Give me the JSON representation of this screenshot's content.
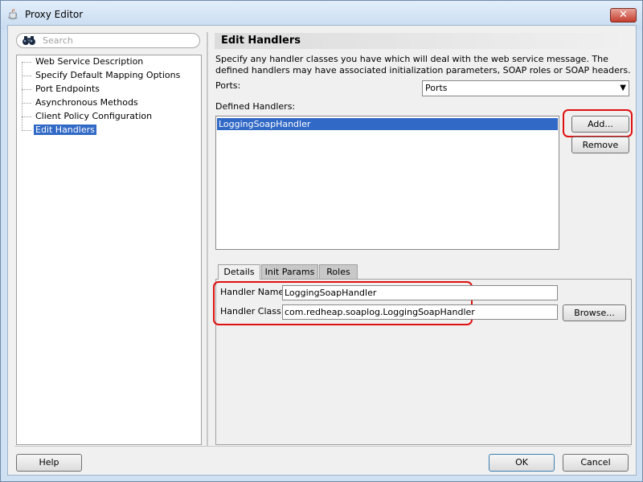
{
  "window": {
    "title": "Proxy Editor",
    "close_glyph": "✕"
  },
  "search": {
    "placeholder": "Search"
  },
  "tree": {
    "items": [
      {
        "label": "Web Service Description",
        "selected": false
      },
      {
        "label": "Specify Default Mapping Options",
        "selected": false
      },
      {
        "label": "Port Endpoints",
        "selected": false
      },
      {
        "label": "Asynchronous Methods",
        "selected": false
      },
      {
        "label": "Client Policy Configuration",
        "selected": false
      },
      {
        "label": "Edit Handlers",
        "selected": true
      }
    ]
  },
  "main": {
    "heading": "Edit Handlers",
    "description": "Specify any handler classes you have which will deal with the web service message. The defined handlers may have associated initialization parameters, SOAP roles or SOAP headers.",
    "ports_label": "Ports:",
    "ports_value": "Ports",
    "defined_handlers_label": "Defined Handlers:",
    "handlers": [
      "LoggingSoapHandler"
    ],
    "add_label": "Add...",
    "remove_label": "Remove",
    "tabs": [
      {
        "label": "Details",
        "active": true
      },
      {
        "label": "Init Params",
        "active": false
      },
      {
        "label": "Roles",
        "active": false
      }
    ],
    "handler_name_label": "Handler Name:",
    "handler_name_value": "LoggingSoapHandler",
    "handler_class_label": "Handler Class:",
    "handler_class_value": "com.redheap.soaplog.LoggingSoapHandler",
    "browse_label": "Browse..."
  },
  "footer": {
    "help_label": "Help",
    "ok_label": "OK",
    "cancel_label": "Cancel"
  },
  "colors": {
    "selection": "#3169c6",
    "highlight": "#e01010"
  }
}
